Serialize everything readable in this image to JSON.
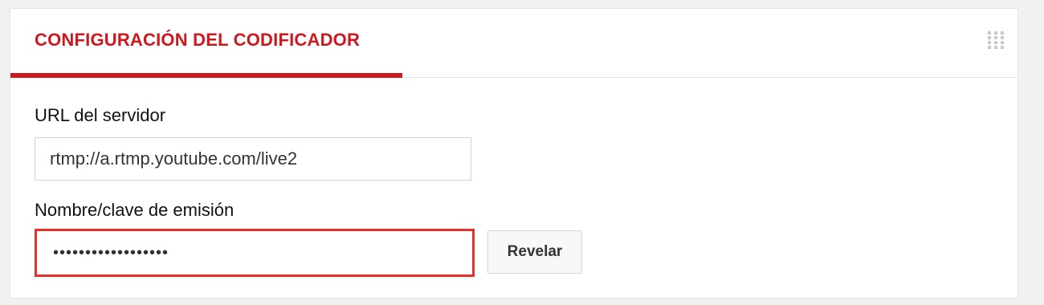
{
  "panel": {
    "tab": {
      "label": "CONFIGURACIÓN DEL CODIFICADOR"
    },
    "grip_icon": "drag-grip-icon"
  },
  "server_url": {
    "label": "URL del servidor",
    "value": "rtmp://a.rtmp.youtube.com/live2"
  },
  "stream_key": {
    "label": "Nombre/clave de emisión",
    "value": "••••••••••••••••••"
  },
  "reveal_button": {
    "label": "Revelar"
  },
  "colors": {
    "accent": "#cc181e",
    "highlight_border": "#e8302a",
    "background": "#f1f1f1",
    "panel": "#ffffff"
  }
}
